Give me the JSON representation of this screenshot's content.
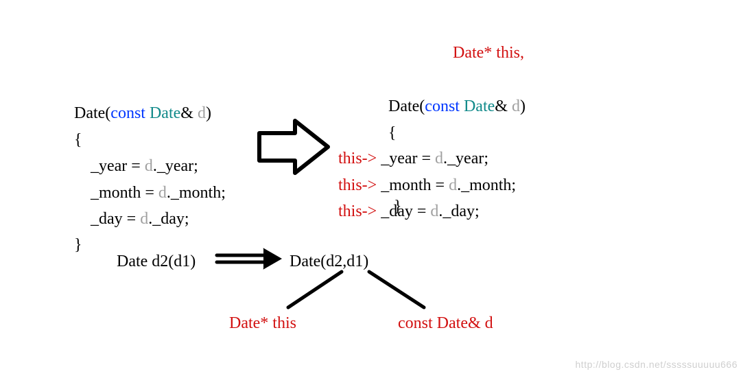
{
  "left_block": {
    "l1_pre": "Date(",
    "l1_const": "const",
    "l1_space": " ",
    "l1_type": "Date",
    "l1_amp": "& ",
    "l1_param": "d",
    "l1_close": ")",
    "l2": "{",
    "l3_lhs": "    _year = ",
    "l3_d": "d",
    "l3_rest": "._year;",
    "l4_lhs": "    _month = ",
    "l4_d": "d",
    "l4_rest": "._month;",
    "l5_lhs": "    _day = ",
    "l5_d": "d",
    "l5_rest": "._day;",
    "l6": "}"
  },
  "right_block": {
    "annot_top": "Date* this,",
    "l1_pre": "Date(",
    "l1_const": "const",
    "l1_space": " ",
    "l1_type": "Date",
    "l1_amp": "& ",
    "l1_param": "d",
    "l1_close": ")",
    "l2": "{",
    "tp": "this->",
    "l3_lhs": " _year = ",
    "l3_d": "d",
    "l3_rest": "._year;",
    "l4_lhs": " _month = ",
    "l4_d": "d",
    "l4_rest": "._month;",
    "l5_lhs": " _day = ",
    "l5_d": "d",
    "l5_rest": "._day;",
    "l6": "}"
  },
  "bottom": {
    "decl": "Date d2(d1)",
    "call": "Date(d2,d1)",
    "lbl_this": "Date* this",
    "lbl_d_pre": "const",
    "lbl_d_sp": " ",
    "lbl_d_type": "Date",
    "lbl_d_rest": "& d"
  },
  "watermark": "http://blog.csdn.net/sssssuuuuu666"
}
